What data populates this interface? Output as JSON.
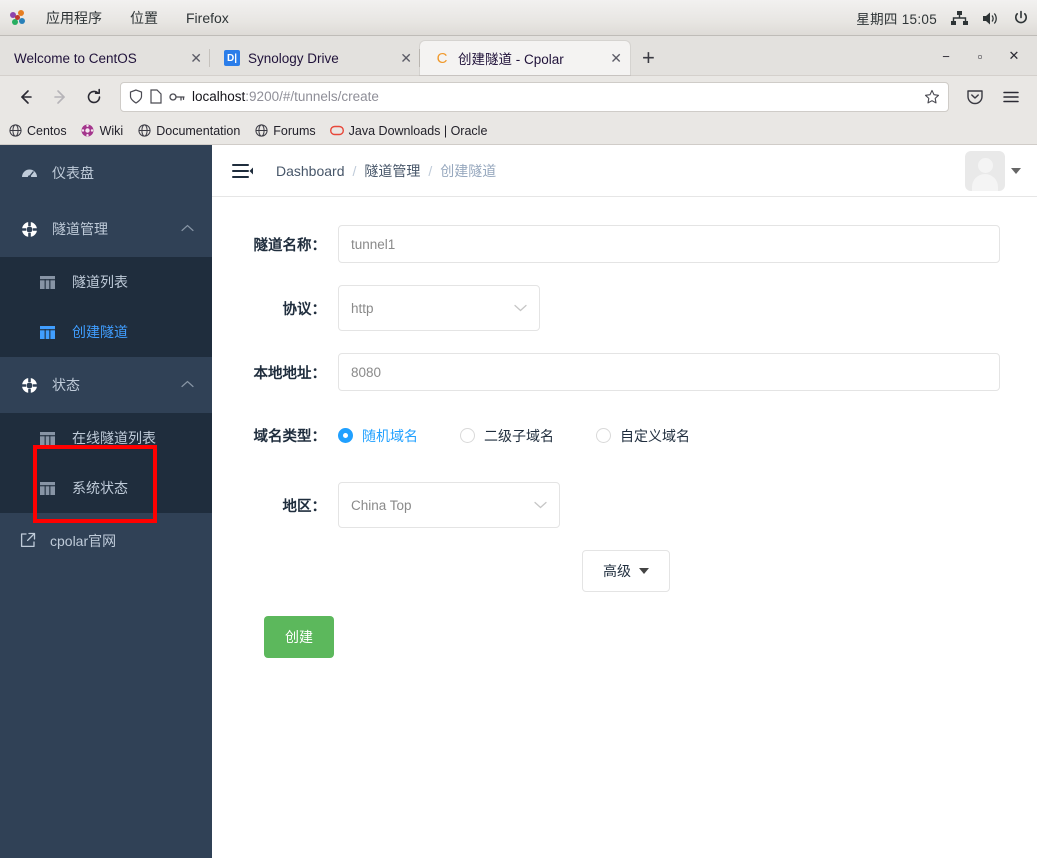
{
  "desktop": {
    "menus": [
      "应用程序",
      "位置",
      "Firefox"
    ],
    "logo_icon": "gnome-logo-icon",
    "tray": {
      "clock": "星期四 15:05",
      "network_icon": "network-icon",
      "volume_icon": "volume-icon",
      "power_icon": "power-icon"
    }
  },
  "browser": {
    "tabs": [
      {
        "title": "Welcome to CentOS",
        "favicon": "none",
        "close_icon": "close-icon",
        "active": false
      },
      {
        "title": "Synology Drive",
        "favicon": "synology-icon",
        "close_icon": "close-icon",
        "active": false
      },
      {
        "title": "创建隧道 - Cpolar",
        "favicon": "cpolar-icon",
        "close_icon": "close-icon",
        "active": true
      }
    ],
    "new_tab_label": "+",
    "window_controls": {
      "minimize": "−",
      "maximize": "▫",
      "close": "✕"
    },
    "nav": {
      "back_icon": "back-arrow-icon",
      "forward_icon": "forward-arrow-icon",
      "reload_icon": "reload-icon"
    },
    "urlbar": {
      "shield_icon": "shield-icon",
      "page_icon": "page-icon",
      "key_icon": "key-icon",
      "host": "localhost",
      "path": ":9200/#/tunnels/create",
      "bookmark_icon": "star-icon"
    },
    "toolbar_right": {
      "pocket_icon": "pocket-icon",
      "menu_icon": "hamburger-menu-icon"
    },
    "bookmarks": [
      {
        "label": "Centos",
        "icon": "globe-icon"
      },
      {
        "label": "Wiki",
        "icon": "wiki-icon"
      },
      {
        "label": "Documentation",
        "icon": "globe-icon"
      },
      {
        "label": "Forums",
        "icon": "globe-icon"
      },
      {
        "label": "Java Downloads | Oracle",
        "icon": "oracle-icon"
      }
    ]
  },
  "app": {
    "sidebar": {
      "dashboard": {
        "label": "仪表盘",
        "icon": "dashboard-icon"
      },
      "groups": [
        {
          "label": "隧道管理",
          "icon": "tunnel-icon",
          "caret": "chevron-up-icon",
          "items": [
            {
              "label": "隧道列表",
              "icon": "grid-icon",
              "active": false
            },
            {
              "label": "创建隧道",
              "icon": "grid-icon",
              "active": true
            }
          ]
        },
        {
          "label": "状态",
          "icon": "status-icon",
          "caret": "chevron-up-icon",
          "items": [
            {
              "label": "在线隧道列表",
              "icon": "grid-icon",
              "active": false
            },
            {
              "label": "系统状态",
              "icon": "grid-icon",
              "active": false
            }
          ]
        }
      ],
      "external_link": {
        "label": "cpolar官网",
        "icon": "external-link-icon"
      }
    },
    "topbar": {
      "menu_icon": "collapse-menu-icon",
      "breadcrumb": [
        "Dashboard",
        "隧道管理",
        "创建隧道"
      ],
      "separator": "/",
      "avatar_icon": "avatar-icon",
      "avatar_caret": "chevron-down-icon"
    },
    "form": {
      "tunnel_name": {
        "label": "隧道名称：",
        "value": "tunnel1"
      },
      "protocol": {
        "label": "协议：",
        "value": "http",
        "chevron": "chevron-down-icon"
      },
      "local_addr": {
        "label": "本地地址：",
        "value": "8080"
      },
      "domain_type": {
        "label": "域名类型：",
        "options": [
          {
            "label": "随机域名",
            "selected": true
          },
          {
            "label": "二级子域名",
            "selected": false
          },
          {
            "label": "自定义域名",
            "selected": false
          }
        ]
      },
      "region": {
        "label": "地区：",
        "value": "China Top",
        "chevron": "chevron-down-icon"
      },
      "advanced_button": "高级",
      "create_button": "创建"
    }
  },
  "annotation": {
    "type": "red-rectangle",
    "color": "#ff0000"
  }
}
